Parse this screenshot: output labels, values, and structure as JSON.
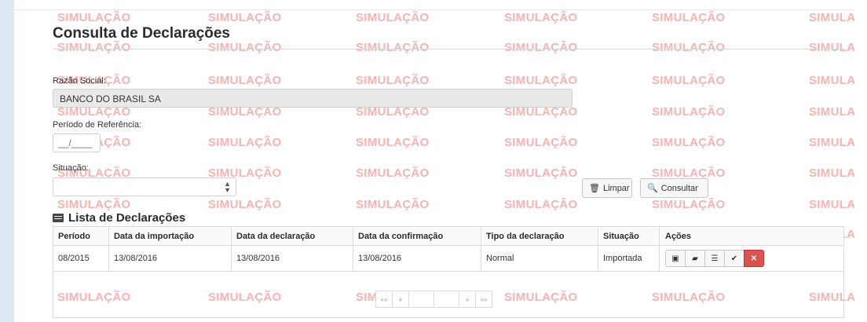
{
  "page": {
    "title": "Consulta de Declarações",
    "watermark": "SIMULAÇÃO",
    "watermark_edge": "SIMULA"
  },
  "form": {
    "razao_social_label": "Razão Social:",
    "razao_social_value": "BANCO DO BRASIL SA",
    "periodo_label": "Período de Referência:",
    "periodo_placeholder": "__/____",
    "situacao_label": "Situação:",
    "situacao_value": ""
  },
  "buttons": {
    "limpar_icon": "trash-icon",
    "limpar_label": "Limpar",
    "consultar_icon": "search-icon",
    "consultar_label": "Consultar"
  },
  "list": {
    "title_icon": "list-icon",
    "title": "Lista de Declarações",
    "columns": [
      "Período",
      "Data da importação",
      "Data da declaração",
      "Data da confirmação",
      "Tipo da declaração",
      "Situação",
      "Ações"
    ],
    "rows": [
      {
        "periodo": "08/2015",
        "data_importacao": "13/08/2016",
        "data_declaracao": "13/08/2016",
        "data_confirmacao": "13/08/2016",
        "tipo": "Normal",
        "situacao": "Importada"
      }
    ],
    "actions": [
      "view-icon",
      "print-icon",
      "list-icon",
      "check-icon",
      "close-icon"
    ],
    "pagination": [
      "««",
      "«",
      "",
      "",
      "»",
      "»»"
    ]
  },
  "colors": {
    "watermark": "#f5b3b3",
    "danger": "#d9534f",
    "left_bar": "#dce9f4"
  }
}
